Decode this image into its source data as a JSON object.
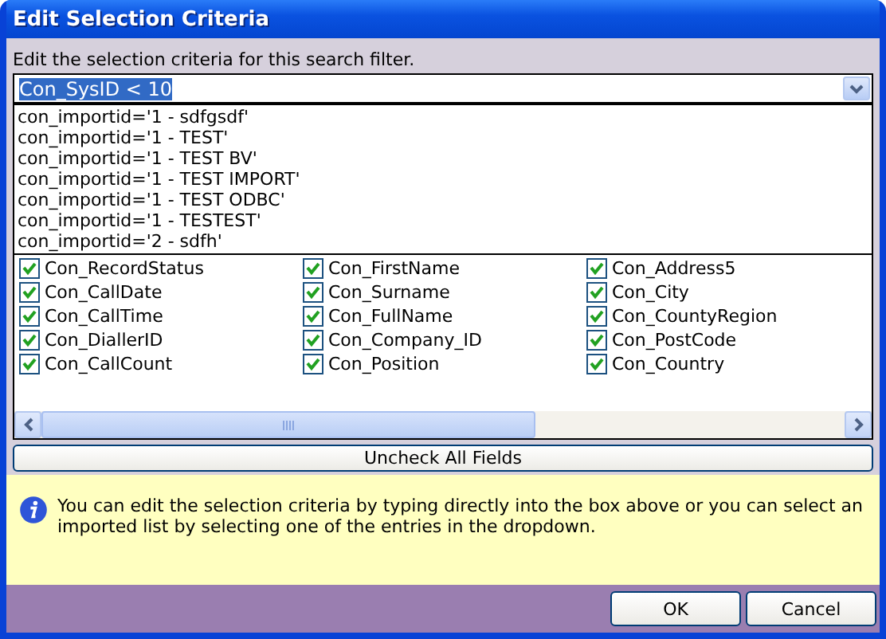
{
  "window": {
    "title": "Edit Selection Criteria"
  },
  "instruction": "Edit the selection criteria for this search filter.",
  "criteria": {
    "value": "Con_SysID < 10",
    "text_selected": true
  },
  "dropdown_options": [
    {
      "label": "con_importid='1 - sdfgsdf'",
      "selected": false
    },
    {
      "label": "con_importid='1 - TEST'",
      "selected": false
    },
    {
      "label": "con_importid='1 - TEST BV'",
      "selected": false
    },
    {
      "label": "con_importid='1 - TEST IMPORT'",
      "selected": false
    },
    {
      "label": "con_importid='1 - TEST ODBC'",
      "selected": false
    },
    {
      "label": "con_importid='1 - TESTEST'",
      "selected": false
    },
    {
      "label": "con_importid='2 - sdfh'",
      "selected": false
    }
  ],
  "field_columns": [
    [
      {
        "label": "Con_RecordStatus",
        "checked": true
      },
      {
        "label": "Con_CallDate",
        "checked": true
      },
      {
        "label": "Con_CallTime",
        "checked": true
      },
      {
        "label": "Con_DiallerID",
        "checked": true
      },
      {
        "label": "Con_CallCount",
        "checked": true
      }
    ],
    [
      {
        "label": "Con_FirstName",
        "checked": true
      },
      {
        "label": "Con_Surname",
        "checked": true
      },
      {
        "label": "Con_FullName",
        "checked": true
      },
      {
        "label": "Con_Company_ID",
        "checked": true
      },
      {
        "label": "Con_Position",
        "checked": true
      }
    ],
    [
      {
        "label": "Con_Address5",
        "checked": true
      },
      {
        "label": "Con_City",
        "checked": true
      },
      {
        "label": "Con_CountyRegion",
        "checked": true
      },
      {
        "label": "Con_PostCode",
        "checked": true
      },
      {
        "label": "Con_Country",
        "checked": true
      }
    ]
  ],
  "uncheck_button": "Uncheck All Fields",
  "info": "You can edit the selection criteria by typing directly into the box above or you can select an imported list by selecting one of the entries in the dropdown.",
  "buttons": [
    "OK",
    "Cancel"
  ]
}
